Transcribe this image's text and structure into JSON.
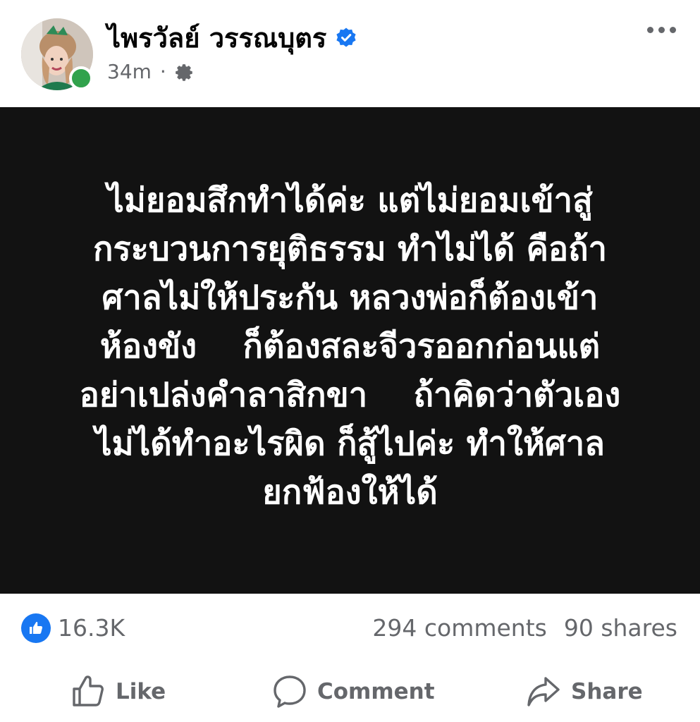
{
  "author": {
    "name": "ไพรวัลย์ วรรณบุตร",
    "verified_icon": "verified-badge-icon",
    "online_status_color": "#31a24c"
  },
  "meta": {
    "time": "34m",
    "separator": "·",
    "audience_icon": "gear-icon"
  },
  "post": {
    "background_color": "#121212",
    "text_color": "#ffffff",
    "text": "ไม่ยอมสึกทำได้ค่ะ แต่ไม่ยอมเข้าสู่\nกระบวนการยุติธรรม ทำไม่ได้ คือถ้า\nศาลไม่ให้ประกัน หลวงพ่อก็ต้องเข้า\nห้องขัง    ก็ต้องสละจีวรออกก่อนแต่\nอย่าเปล่งคำลาสิกขา    ถ้าคิดว่าตัวเอง\nไม่ได้ทำอะไรผิด ก็สู้ไปค่ะ ทำให้ศาล\nยกฟ้องให้ได้"
  },
  "stats": {
    "reaction_icon": "like-reaction-icon",
    "reaction_count": "16.3K",
    "comments": "294 comments",
    "shares": "90 shares"
  },
  "actions": {
    "like_label": "Like",
    "comment_label": "Comment",
    "share_label": "Share"
  },
  "colors": {
    "brand_blue": "#1877f2",
    "secondary_text": "#65676b"
  }
}
